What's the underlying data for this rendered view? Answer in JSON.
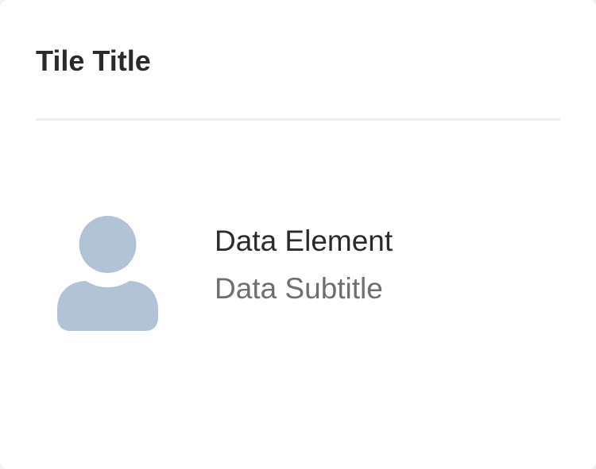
{
  "tile": {
    "title": "Tile Title"
  },
  "data_item": {
    "icon": "user-icon",
    "icon_color": "#b1c3d4",
    "title": "Data Element",
    "subtitle": "Data Subtitle"
  },
  "colors": {
    "title_text": "#2a2a2a",
    "subtitle_text": "#6f6f6f",
    "divider": "#ededed",
    "background": "#ffffff"
  }
}
